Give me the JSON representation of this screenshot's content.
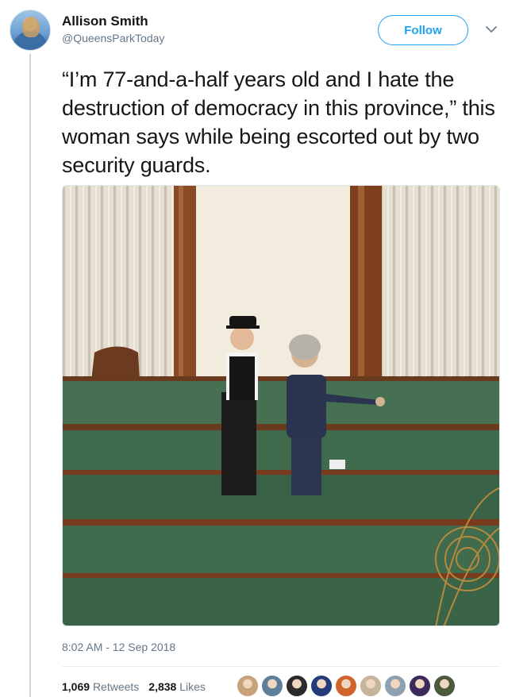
{
  "author": {
    "name": "Allison Smith",
    "handle": "@QueensParkToday"
  },
  "follow_button": {
    "label": "Follow"
  },
  "tweet": {
    "text": "“I’m 77-and-a-half years old and I hate the destruction of democracy in this province,” this woman says while being escorted out by two security guards.",
    "timestamp": "8:02 AM - 12 Sep 2018"
  },
  "stats": {
    "retweets_count": "1,069",
    "retweets_label": "Retweets",
    "likes_count": "2,838",
    "likes_label": "Likes"
  },
  "icons": {
    "caret": "chevron-down-icon"
  },
  "colors": {
    "accent": "#1da1f2",
    "secondary_text": "#657786",
    "bench_green": "#3f6a4c",
    "wood": "#7a3a1d"
  },
  "liker_colors": [
    "#c7a27a",
    "#5e7f9a",
    "#2b2b2b",
    "#243a7a",
    "#d0642a",
    "#c6b59a",
    "#8fa0b0",
    "#3b2a5a",
    "#4a5a3a"
  ]
}
